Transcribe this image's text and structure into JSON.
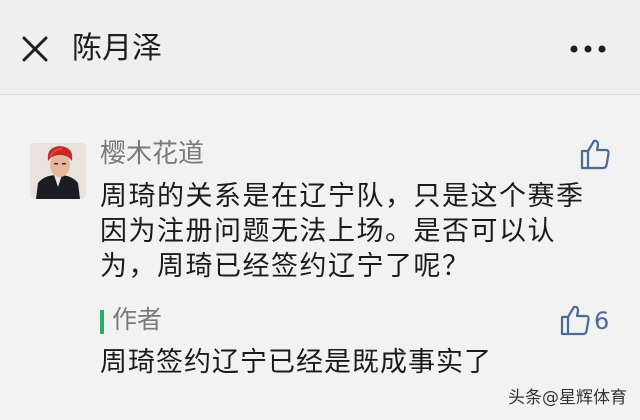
{
  "header": {
    "title": "陈月泽",
    "close_icon": "close-icon",
    "more_icon": "more-horizontal-icon"
  },
  "comment": {
    "nickname": "樱木花道",
    "text": "周琦的关系是在辽宁队，只是这个赛季因为注册问题无法上场。是否可以认为，周琦已经签约辽宁了呢？",
    "like_icon": "thumbs-up-icon"
  },
  "reply": {
    "author_label": "作者",
    "like_count": "6",
    "text": "周琦签约辽宁已经是既成事实了",
    "accent_color": "#2aae67"
  },
  "watermark": "头条@星辉体育"
}
